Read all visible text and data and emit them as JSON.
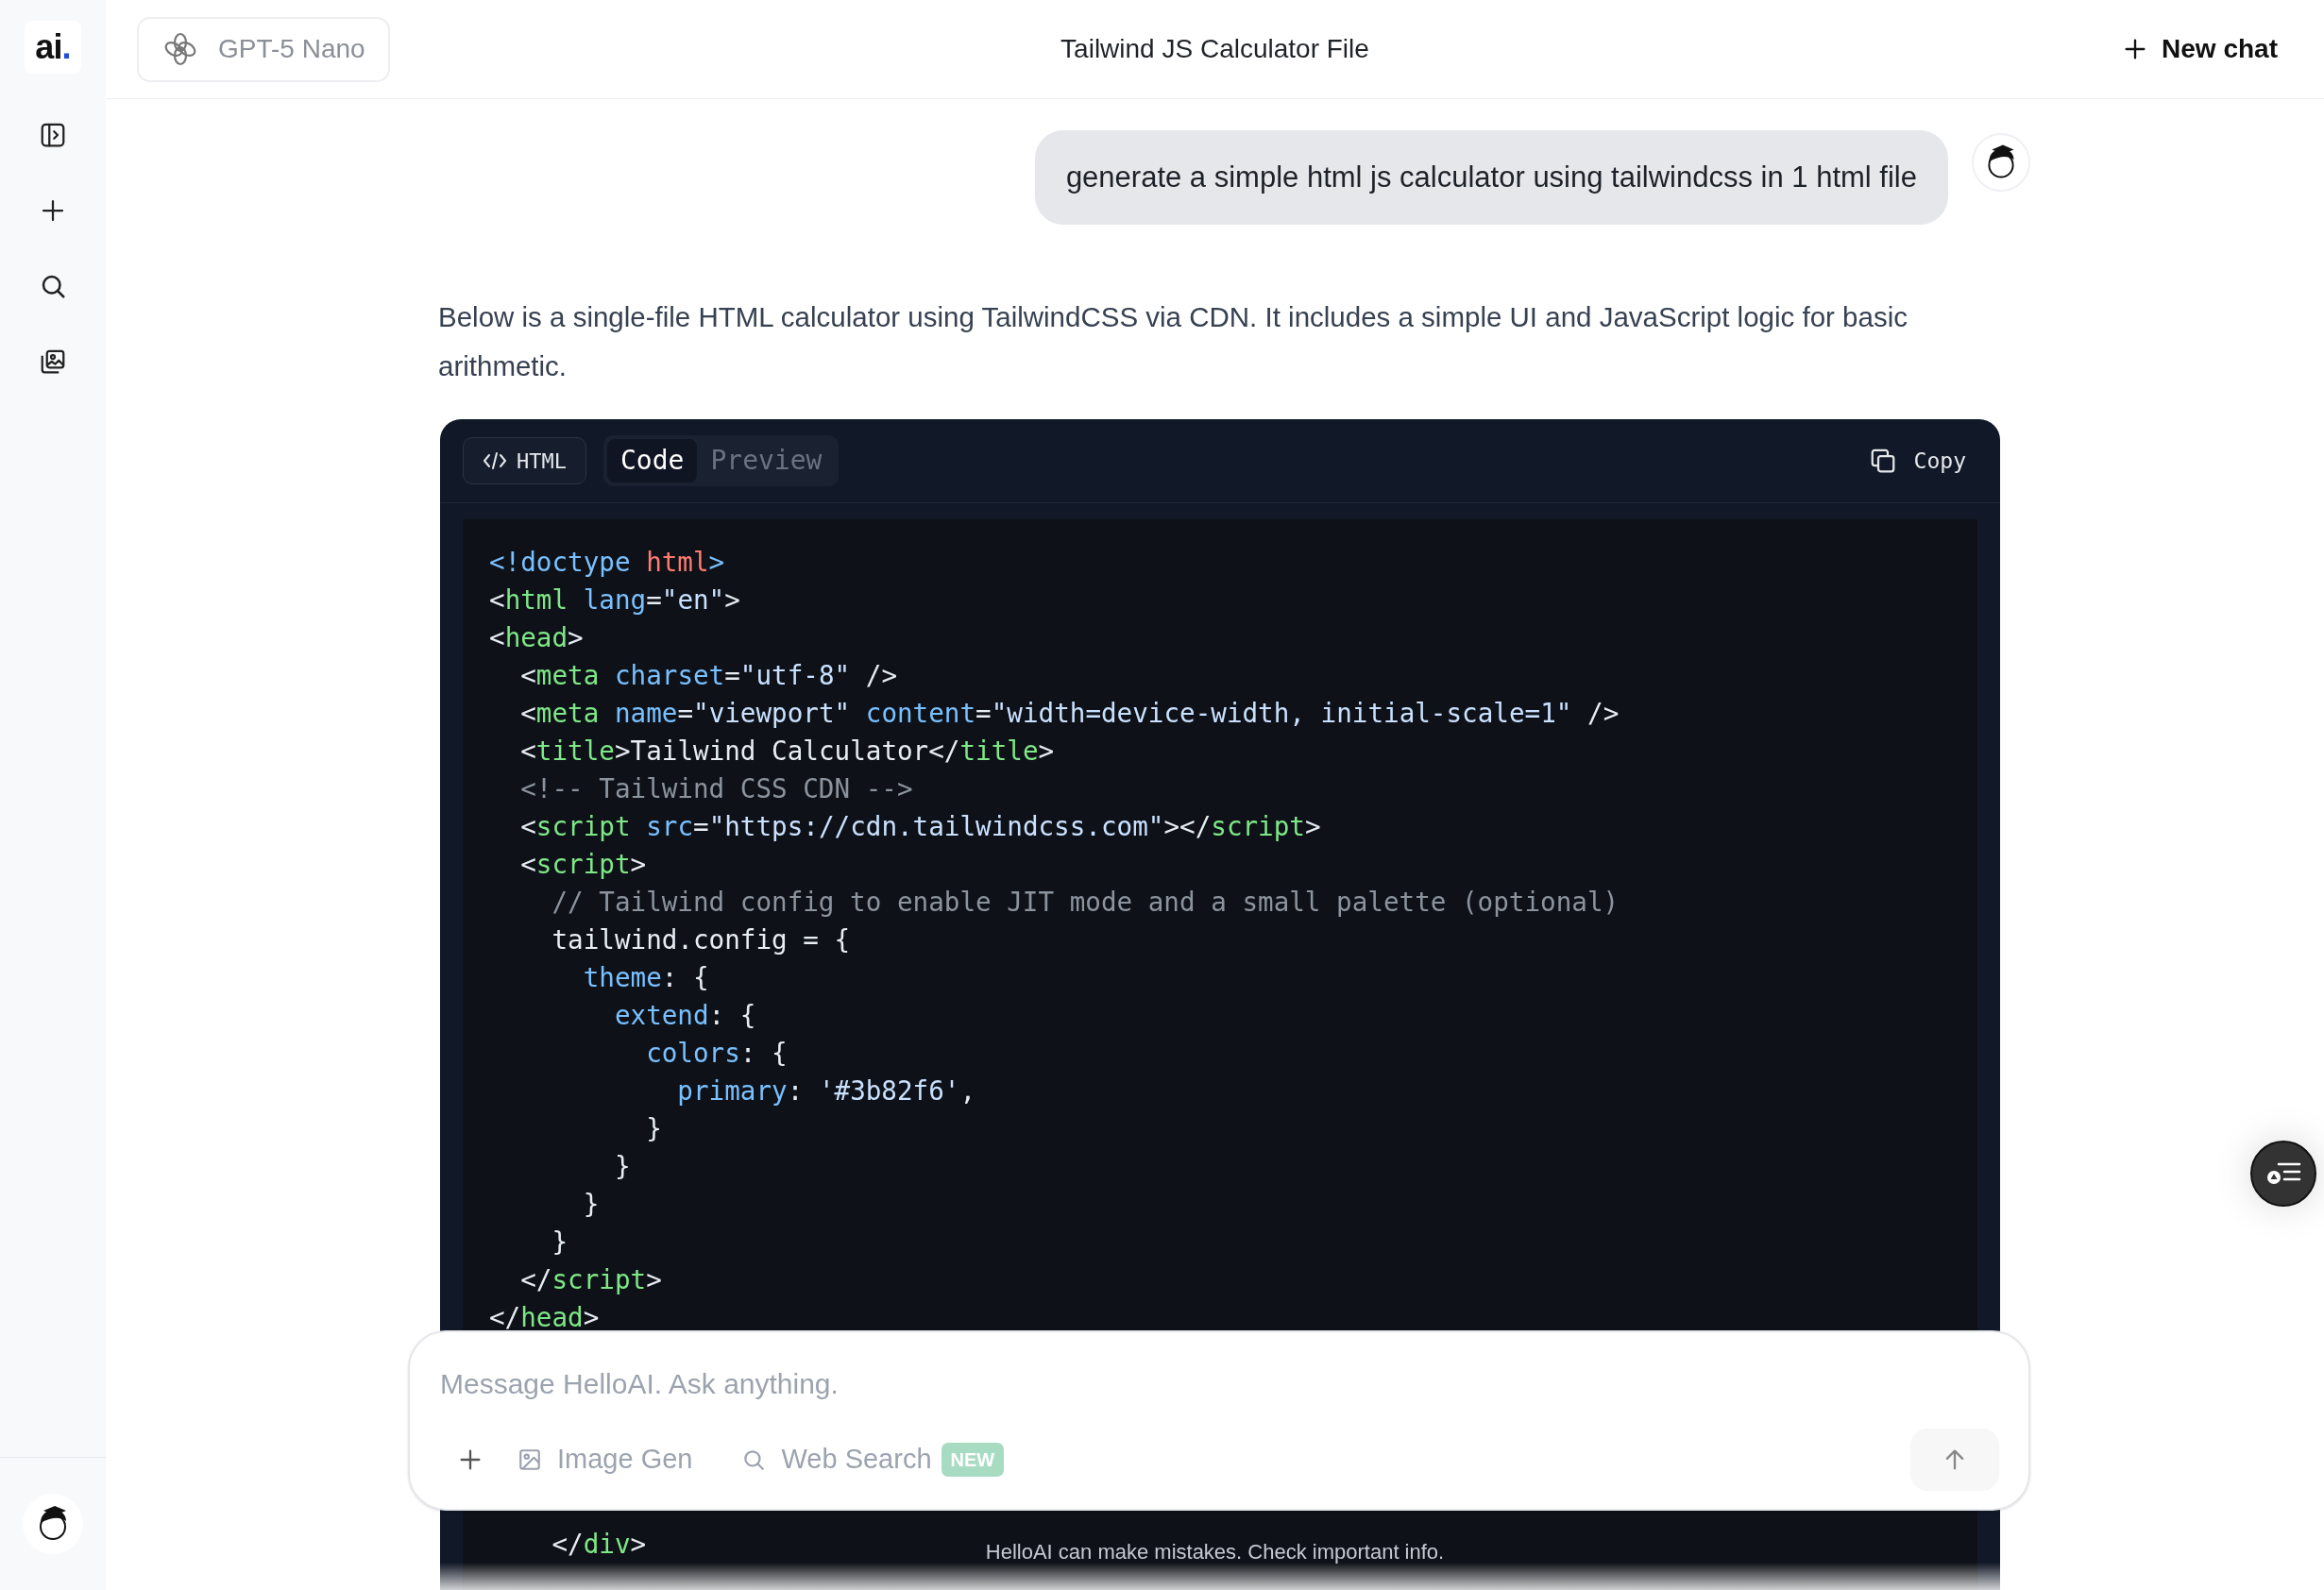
{
  "sidebar": {
    "logo": "ai."
  },
  "header": {
    "model": "GPT-5 Nano",
    "title": "Tailwind JS Calculator File",
    "new_chat": "New chat"
  },
  "messages": [
    {
      "kind": "user",
      "text": "generate a simple html js calculator using tailwindcss in 1 html file"
    },
    {
      "kind": "assistant",
      "text": "Below is a single-file HTML calculator using TailwindCSS via CDN. It includes a simple UI and JavaScript logic for basic arithmetic."
    }
  ],
  "code_block": {
    "language": "HTML",
    "tabs": [
      {
        "label": "Code",
        "selected": true
      },
      {
        "label": "Preview",
        "selected": false
      }
    ],
    "copy": "Copy",
    "lines_top": [
      "<!doctype html>",
      "<html lang=\"en\">",
      "<head>",
      "  <meta charset=\"utf-8\" />",
      "  <meta name=\"viewport\" content=\"width=device-width, initial-scale=1\" />",
      "  <title>Tailwind Calculator</title>",
      "  <!-- Tailwind CSS CDN -->",
      "  <script src=\"https://cdn.tailwindcss.com\"></script>",
      "  <script>",
      "    // Tailwind config to enable JIT mode and a small palette (optional)",
      "    tailwind.config = {",
      "      theme: {",
      "        extend: {",
      "          colors: {",
      "            primary: '#3b82f6',",
      "          }",
      "        }",
      "      }",
      "    }",
      "  </script>",
      "</head>"
    ],
    "lines_bottom": [
      "    </div>"
    ]
  },
  "composer": {
    "placeholder": "Message HelloAI. Ask anything.",
    "tools": [
      {
        "kind": "image",
        "label": "Image Gen"
      },
      {
        "kind": "search",
        "label": "Web Search",
        "badge": "NEW"
      }
    ]
  },
  "disclaimer": "HelloAI can make mistakes. Check important info."
}
